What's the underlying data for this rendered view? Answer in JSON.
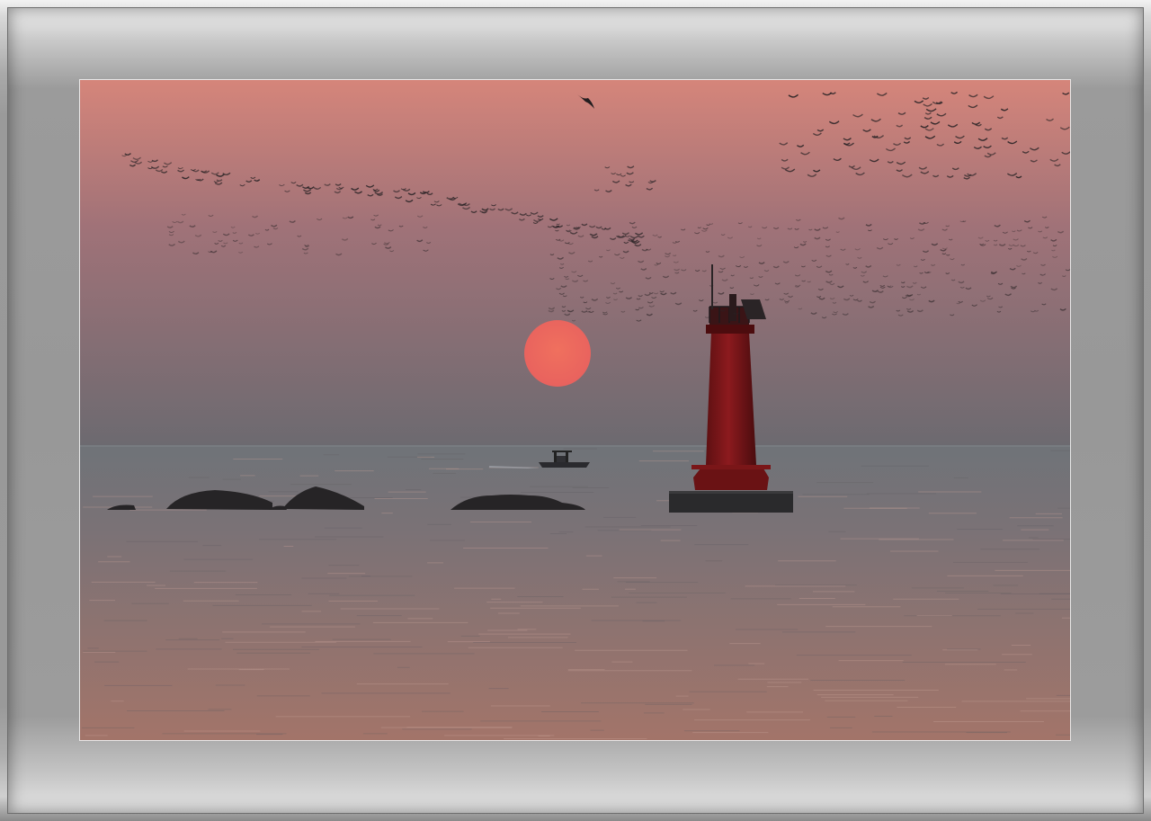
{
  "scene": {
    "subject": "lighthouse-at-sunset",
    "colors": {
      "sky_top": "#d5857a",
      "sky_mid": "#a07278",
      "sky_low": "#6c6a70",
      "sea_far": "#6f7378",
      "sea_near": "#a37469",
      "sun": "#e8625e",
      "lighthouse": "#8c1a1e",
      "silhouette": "#222022",
      "mat": "#9a9a9a"
    }
  }
}
